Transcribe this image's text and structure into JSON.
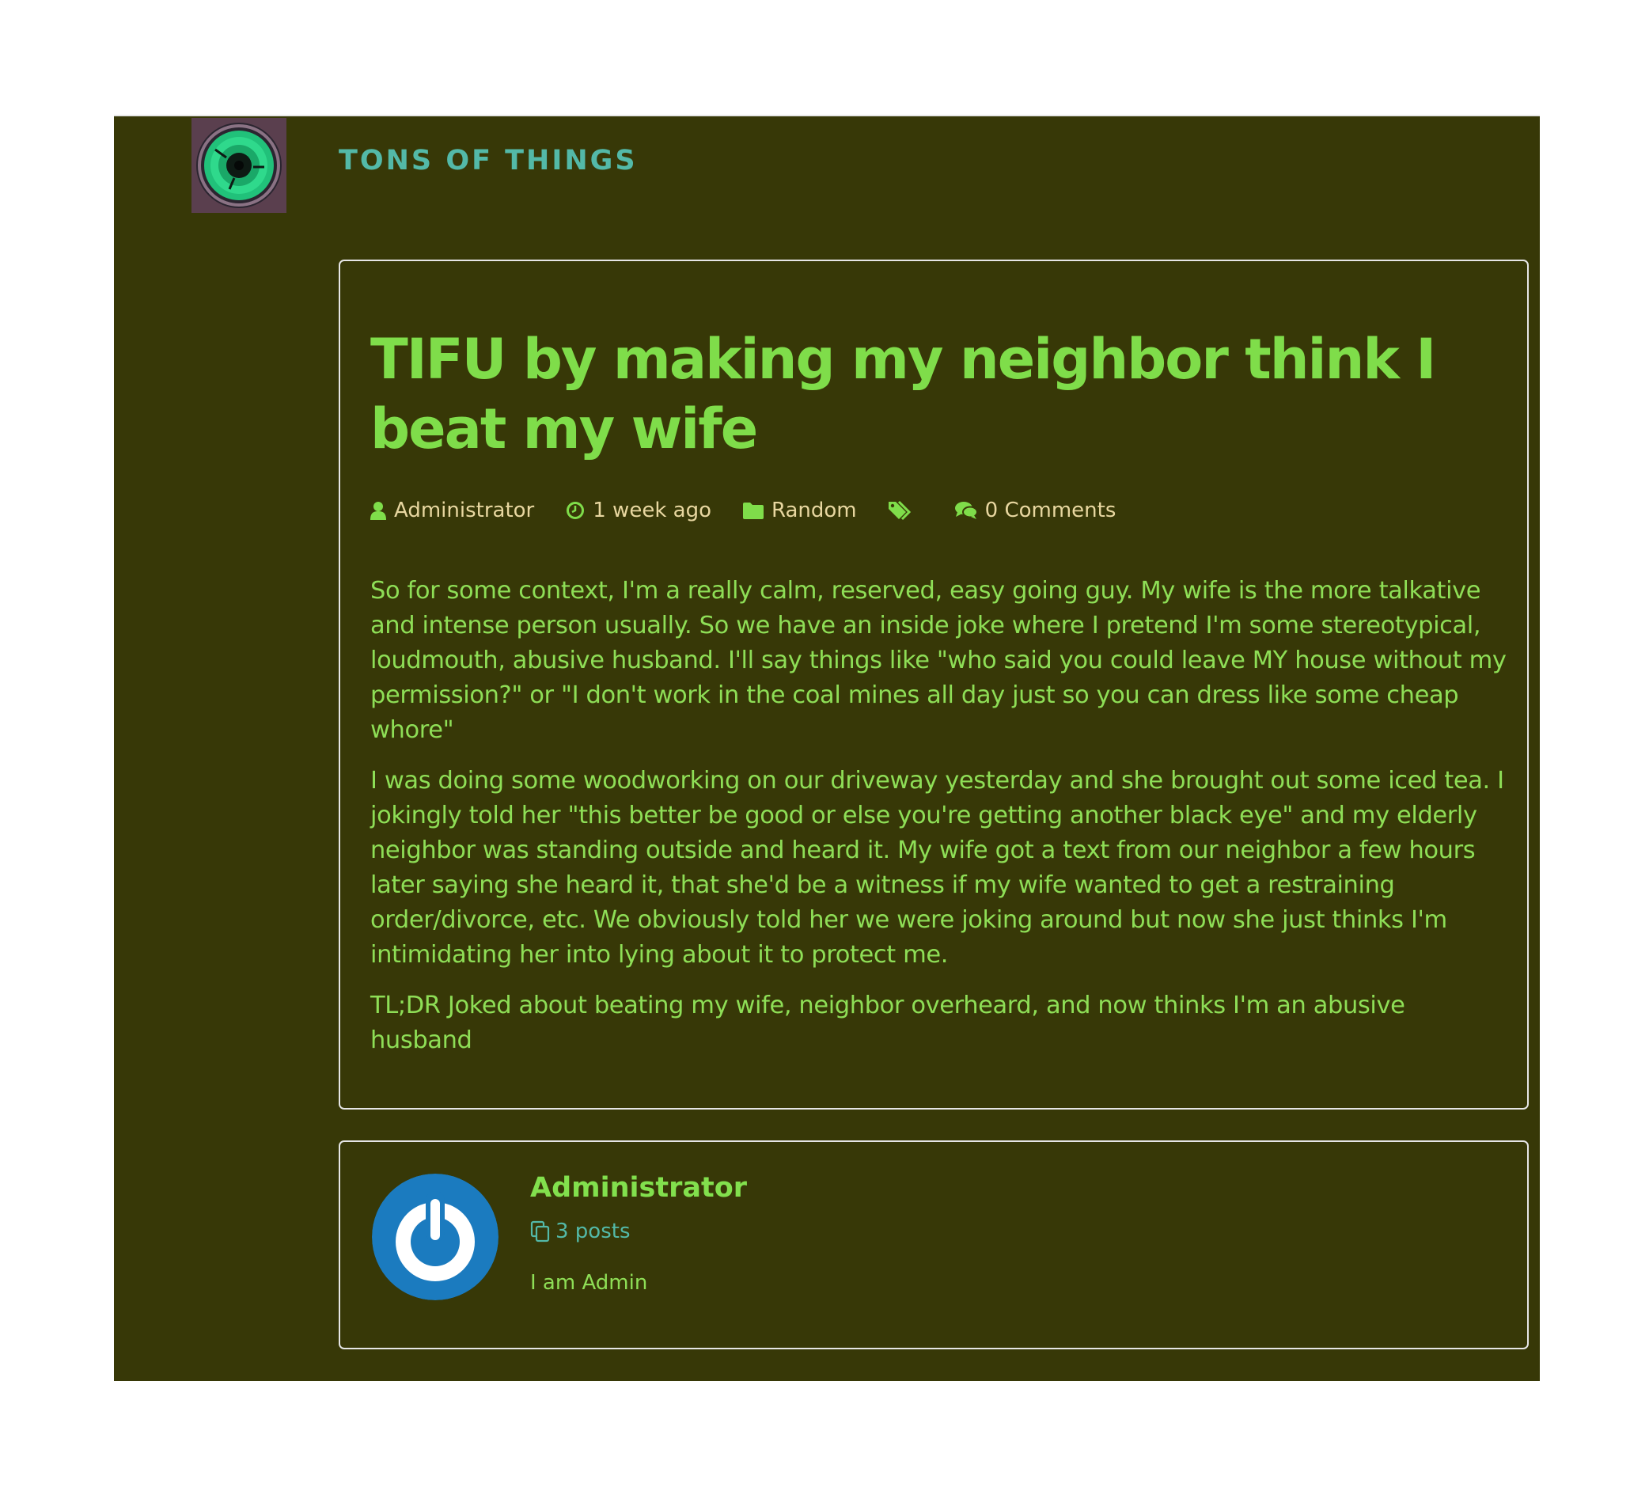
{
  "site": {
    "title": "TONS OF THINGS",
    "logo_icon": "vinyl-disc-logo"
  },
  "colors": {
    "background": "#373807",
    "title_accent": "#53b9a8",
    "heading_green": "#7fdd4a",
    "body_green": "#8ede56",
    "meta_text": "#e8d7a0",
    "avatar_blue": "#1b7bbf"
  },
  "post": {
    "title": "TIFU by making my neighbor think I beat my wife",
    "meta": {
      "author": "Administrator",
      "date": "1 week ago",
      "category": "Random",
      "comments": "0 Comments",
      "icons": [
        "user-icon",
        "clock-icon",
        "folder-icon",
        "tags-icon",
        "comments-icon"
      ]
    },
    "paragraphs": [
      "So for some context, I'm a really calm, reserved, easy going guy. My wife is the more talkative and intense person usually. So we have an inside joke where I pretend I'm some stereotypical, loudmouth, abusive husband. I'll say things like \"who said you could leave MY house without my permission?\" or \"I don't work in the coal mines all day just so you can dress like some cheap whore\"",
      "I was doing some woodworking on our driveway yesterday and she brought out some iced tea. I jokingly told her \"this better be good or else you're getting another black eye\" and my elderly neighbor was standing outside and heard it. My wife got a text from our neighbor a few hours later saying she heard it, that she'd be a witness if my wife wanted to get a restraining order/divorce, etc. We obviously told her we were joking around but now she just thinks I'm intimidating her into lying about it to protect me.",
      "TL;DR Joked about beating my wife, neighbor overheard, and now thinks I'm an abusive husband"
    ]
  },
  "author_box": {
    "name": "Administrator",
    "posts": "3 posts",
    "bio": "I am Admin",
    "avatar_icon": "power-icon"
  }
}
